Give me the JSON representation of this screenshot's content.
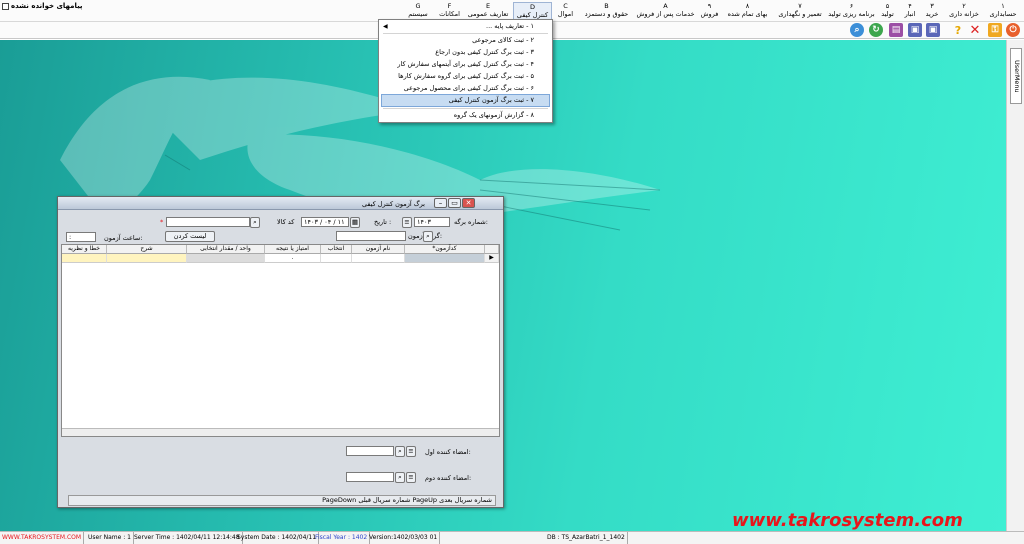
{
  "menubar": {
    "unread_messages": "پیامهای خوانده نشده",
    "items": [
      {
        "key": "۱",
        "label": "حسابداری"
      },
      {
        "key": "۲",
        "label": "خزانه داری"
      },
      {
        "key": "۳",
        "label": "خرید"
      },
      {
        "key": "۴",
        "label": "انبار"
      },
      {
        "key": "۵",
        "label": "تولید"
      },
      {
        "key": "۶",
        "label": "برنامه ریزی تولید"
      },
      {
        "key": "۷",
        "label": "تعمیر و نگهداری"
      },
      {
        "key": "۸",
        "label": "بهای تمام شده"
      },
      {
        "key": "۹",
        "label": "فروش"
      },
      {
        "key": "A",
        "label": "خدمات پس از فروش"
      },
      {
        "key": "B",
        "label": "حقوق و دستمزد"
      },
      {
        "key": "C",
        "label": "اموال"
      },
      {
        "key": "D",
        "label": "کنترل کیفی"
      },
      {
        "key": "E",
        "label": "تعاریف عمومی"
      },
      {
        "key": "F",
        "label": "امکانات"
      },
      {
        "key": "G",
        "label": "سیستم"
      }
    ]
  },
  "dropdown": {
    "items": [
      "۱ - تعاریف پایه ...",
      "۲ - ثبت کالای مرجوعی",
      "۳ - ثبت برگ کنترل کیفی بدون ارجاع",
      "۴ - ثبت برگ کنترل کیفی برای آیتمهای سفارش کار",
      "۵ - ثبت برگ کنترل کیفی برای گروه سفارش کارها",
      "۶ - ثبت برگ کنترل کیفی برای محصول مرجوعی",
      "۷ - ثبت برگ آزمون کنترل کیفی",
      "۸ - گزارش آزمونهای یک گروه"
    ]
  },
  "umenu": {
    "label": "UserMenu"
  },
  "watermark": "www.takrosystem.com",
  "window": {
    "title": "برگ آزمون کنترل کیفی",
    "sheet_no_label": "شماره برگه:",
    "sheet_no_value": "۱۴۰۳",
    "date_label": "تاریخ :",
    "date_value": "۱۴۰۳ / ۰۴ / ۱۱",
    "item_code_label": "کد کالا",
    "test_group_label": "گروه آزمون:",
    "list_button": "لیست کردن",
    "test_time_label": "ساعت آزمون:",
    "test_time_value": ":",
    "grid_headers": [
      "*کدآزمون",
      "نام آزمون",
      "انتخاب",
      "امتیاز یا نتیجه",
      "واحد / مقدار انتخابی",
      "شرح",
      "خطا و نظریه"
    ],
    "first_signer_label": "امضاء کننده اول:",
    "second_signer_label": "امضاء کننده دوم:",
    "status_text": "PageDown شماره سریال قبلی  PageUp شماره سریال بعدی"
  },
  "statusbar": {
    "site": "WWW.TAKROSYSTEM.COM",
    "user": "User Name : 1",
    "server_time": "Server Time : 1402/04/11  12:14:48",
    "system_date": "System Date : 1402/04/11",
    "fiscal_year": "Fiscal Year : 1402",
    "version": "Version:1402/03/03   01",
    "db": "DB : TS_AzarBatri_1_1402"
  },
  "colors": {
    "accent": "#e8151b",
    "desktop": "#2fcfbd",
    "highlight": "#c7dcf2"
  }
}
